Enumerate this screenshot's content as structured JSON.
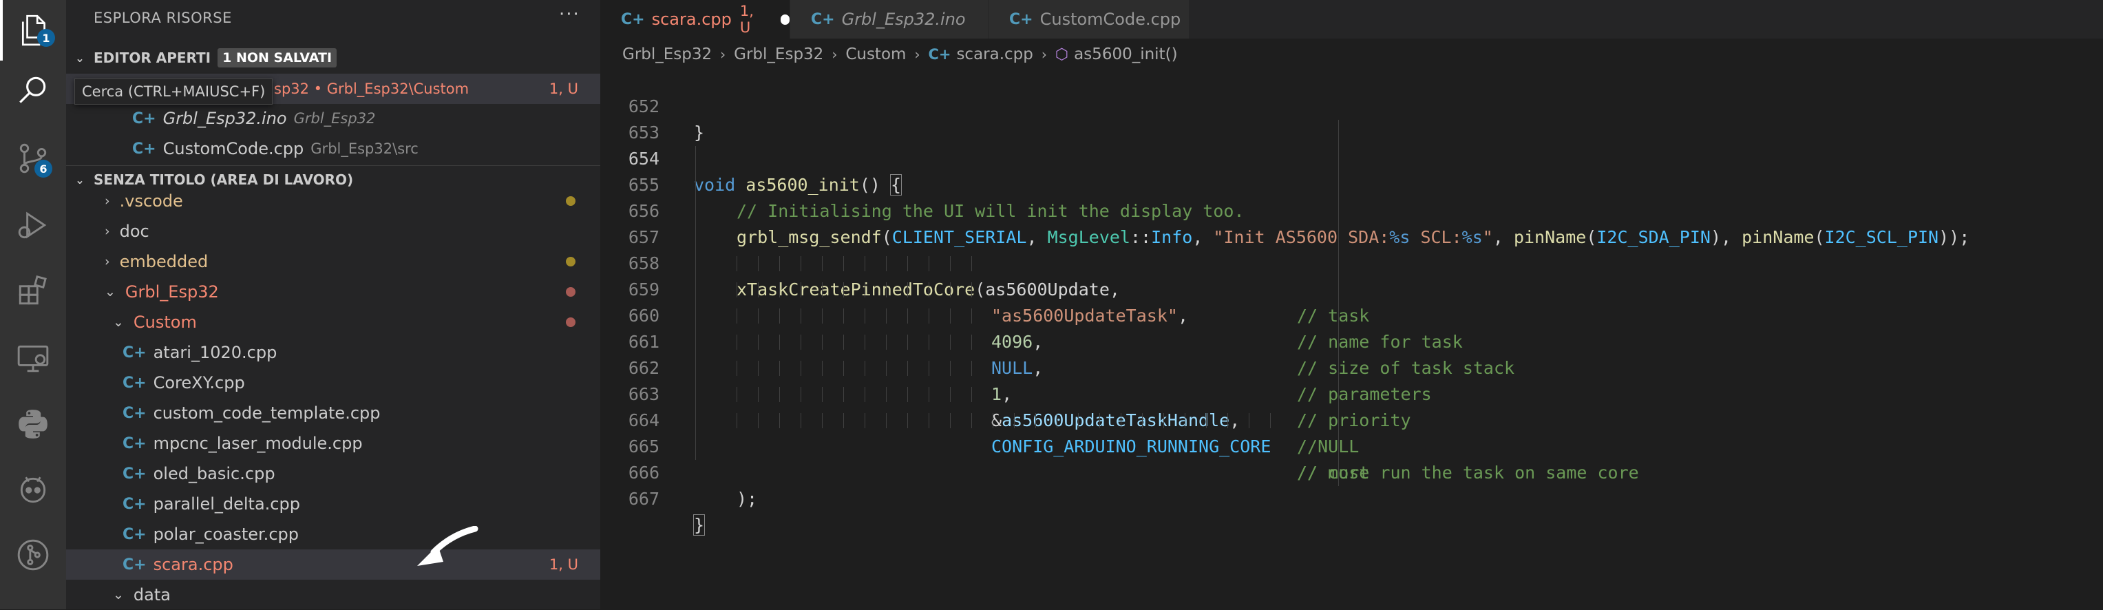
{
  "activity_bar": {
    "explorer_badge": "1",
    "scm_badge": "6"
  },
  "sidebar": {
    "title": "ESPLORA RISORSE",
    "more": "···",
    "open_editors": {
      "header": "EDITOR APERTI",
      "unsaved_badge": "1 NON SALVATI",
      "items": [
        {
          "name": "scara.cpp",
          "path": "Grbl_Esp32 • Grbl_Esp32\\Custom",
          "status": "1, U",
          "visible_path": "sp32 • Grbl_Esp32\\Custom"
        },
        {
          "name": "Grbl_Esp32.ino",
          "path": "Grbl_Esp32"
        },
        {
          "name": "CustomCode.cpp",
          "path": "Grbl_Esp32\\src"
        }
      ]
    },
    "tooltip": "Cerca (CTRL+MAIUSC+F)",
    "workspace": {
      "header": "SENZA TITOLO (AREA DI LAVORO)",
      "tree": [
        {
          "label": ".vscode"
        },
        {
          "label": "doc"
        },
        {
          "label": "embedded"
        },
        {
          "label": "Grbl_Esp32"
        },
        {
          "label": "Custom"
        },
        {
          "label": "atari_1020.cpp"
        },
        {
          "label": "CoreXY.cpp"
        },
        {
          "label": "custom_code_template.cpp"
        },
        {
          "label": "mpcnc_laser_module.cpp"
        },
        {
          "label": "oled_basic.cpp"
        },
        {
          "label": "parallel_delta.cpp"
        },
        {
          "label": "polar_coaster.cpp"
        },
        {
          "label": "scara.cpp",
          "status": "1, U"
        },
        {
          "label": "data"
        }
      ]
    }
  },
  "tabs": [
    {
      "label": "scara.cpp",
      "status": "1, U"
    },
    {
      "label": "Grbl_Esp32.ino"
    },
    {
      "label": "CustomCode.cpp"
    }
  ],
  "breadcrumb": [
    "Grbl_Esp32",
    "Grbl_Esp32",
    "Custom",
    "scara.cpp",
    "as5600_init()"
  ],
  "code": {
    "line_numbers": [
      "652",
      "653",
      "654",
      "655",
      "656",
      "657",
      "658",
      "659",
      "660",
      "661",
      "662",
      "663",
      "664",
      "665",
      "666",
      "667"
    ],
    "l652": "}",
    "l654": {
      "kw": "void",
      "fn": "as5600_init",
      "rest": "() ",
      "brace": "{"
    },
    "l655": "// Initialising the UI will init the display too.",
    "l656": {
      "fn": "grbl_msg_sendf",
      "p1": "(",
      "a1": "CLIENT_SERIAL",
      "c1": ", ",
      "a2": "MsgLevel",
      "c2": "::",
      "a3": "Info",
      "c3": ", ",
      "s1": "\"Init AS5600 SDA:",
      "f1": "%s",
      "s2": " SCL:",
      "f2": "%s",
      "s3": "\"",
      "c4": ", ",
      "fn2": "pinName",
      "p2": "(",
      "a4": "I2C_SDA_PIN",
      "p3": "), ",
      "fn3": "pinName",
      "p4": "(",
      "a5": "I2C_SCL_PIN",
      "p5": "));"
    },
    "l658": {
      "fn": "xTaskCreatePinnedToCore",
      "p": "(",
      "arg": "as5600Update",
      "c": ",",
      "cm": "// task"
    },
    "l659": {
      "str": "\"as5600UpdateTask\"",
      "c": ",",
      "cm": "// name for task"
    },
    "l660": {
      "num": "4096",
      "c": ",",
      "cm": "// size of task stack"
    },
    "l661": {
      "kw": "NULL",
      "c": ",",
      "cm": "// parameters"
    },
    "l662": {
      "num": "1",
      "c": ",",
      "cm": "// priority"
    },
    "l663": {
      "amp": "&",
      "var": "as5600UpdateTaskHandle",
      "c": ",",
      "cm": "//NULL"
    },
    "l664": {
      "con": "CONFIG_ARDUINO_RUNNING_CORE",
      "cm": "// must run the task on same core"
    },
    "l665": {
      "cm": "// core"
    },
    "l666": ");",
    "l667": "}"
  },
  "colors": {
    "activity_bg": "#333333",
    "sidebar_bg": "#252526",
    "editor_bg": "#1e1e1e",
    "accent_badge": "#0e639c",
    "untracked": "#f48771",
    "modified": "#e2c08d"
  }
}
